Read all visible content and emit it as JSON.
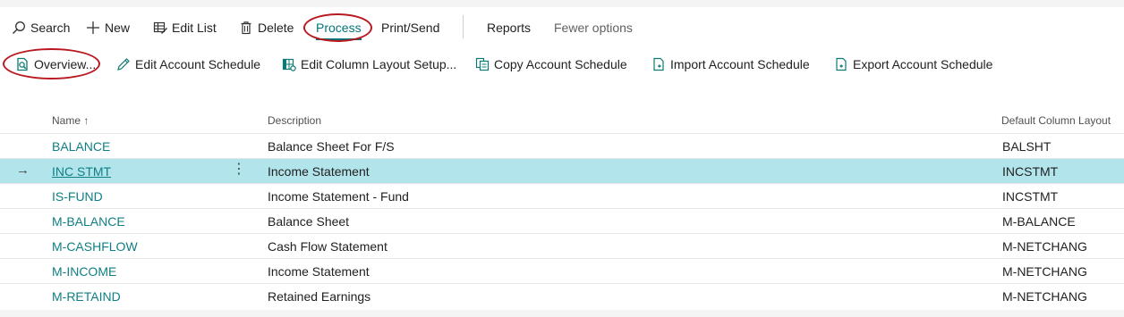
{
  "toolbar": {
    "search_label": "Search",
    "new_label": "New",
    "edit_list_label": "Edit List",
    "delete_label": "Delete",
    "process_label": "Process",
    "print_send_label": "Print/Send",
    "reports_label": "Reports",
    "fewer_options_label": "Fewer options"
  },
  "actions": {
    "overview_label": "Overview...",
    "edit_schedule_label": "Edit Account Schedule",
    "edit_column_layout_label": "Edit Column Layout Setup...",
    "copy_schedule_label": "Copy Account Schedule",
    "import_schedule_label": "Import Account Schedule",
    "export_schedule_label": "Export Account Schedule"
  },
  "grid": {
    "columns": {
      "name": "Name",
      "sort_indicator": "↑",
      "description": "Description",
      "default_column_layout": "Default Column Layout"
    },
    "rows": [
      {
        "name": "BALANCE",
        "description": "Balance Sheet For F/S",
        "layout": "BALSHT"
      },
      {
        "name": "INC STMT",
        "description": "Income Statement",
        "layout": "INCSTMT"
      },
      {
        "name": "IS-FUND",
        "description": "Income Statement - Fund",
        "layout": "INCSTMT"
      },
      {
        "name": "M-BALANCE",
        "description": "Balance Sheet",
        "layout": "M-BALANCE"
      },
      {
        "name": "M-CASHFLOW",
        "description": "Cash Flow Statement",
        "layout": "M-NETCHANG"
      },
      {
        "name": "M-INCOME",
        "description": "Income Statement",
        "layout": "M-NETCHANG"
      },
      {
        "name": "M-RETAIND",
        "description": "Retained Earnings",
        "layout": "M-NETCHANG"
      }
    ],
    "selected_row_marker": "→",
    "row_menu_glyph": "⋮"
  },
  "colors": {
    "accent": "#00757a",
    "selected_row": "#b2e4ec",
    "highlight_ring": "#b9181f"
  },
  "icons": [
    "search-icon",
    "plus-icon",
    "edit-list-icon",
    "trash-icon",
    "overview-icon",
    "pencil-icon",
    "column-layout-icon",
    "copy-icon",
    "import-icon",
    "export-icon"
  ]
}
